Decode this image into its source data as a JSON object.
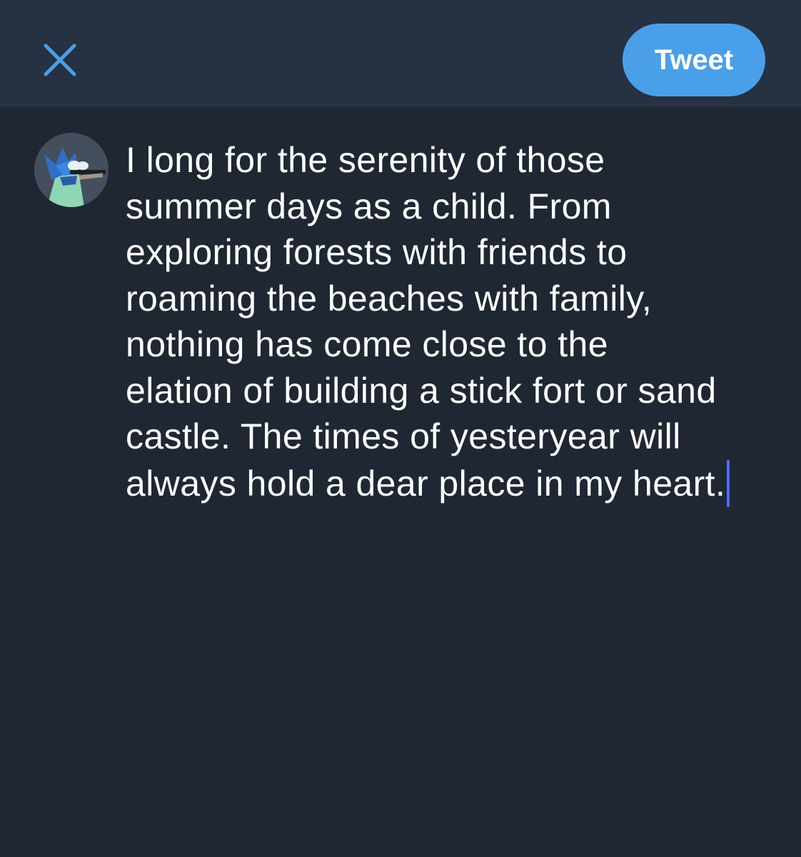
{
  "header": {
    "close_icon": "close-icon",
    "tweet_button_label": "Tweet"
  },
  "composer": {
    "avatar_icon": "avatar-icon",
    "lines": [
      "I long for the serenity of those",
      "summer days as a child. From",
      "exploring forests with friends to",
      "roaming the beaches with family,",
      "nothing has come close to the",
      "elation of building a stick fort or sand",
      "castle. The times of yesteryear will",
      "always hold a dear place in my heart."
    ]
  },
  "colors": {
    "background": "#1f2733",
    "header_background": "#263142",
    "accent": "#4a9fe9",
    "caret": "#4a6cf7",
    "text": "#ffffff"
  }
}
